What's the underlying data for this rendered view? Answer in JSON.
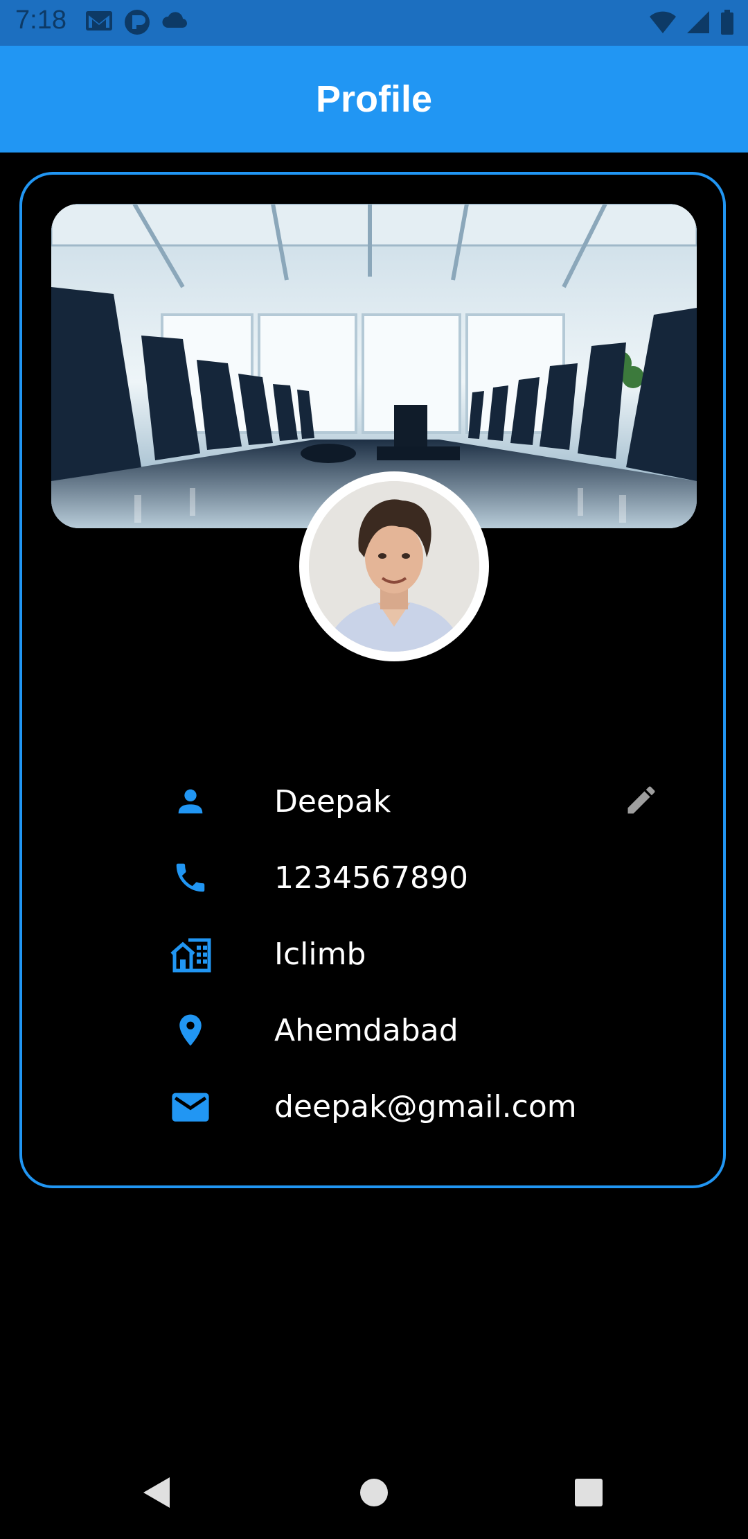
{
  "status_bar": {
    "time": "7:18",
    "left_icons": [
      "gmail-icon",
      "app-icon",
      "cloud-icon"
    ],
    "right_icons": [
      "wifi-icon",
      "signal-icon",
      "battery-icon"
    ]
  },
  "app_bar": {
    "title": "Profile"
  },
  "profile": {
    "cover_image": "conference-room-photo",
    "avatar": "profile-photo",
    "fields": [
      {
        "icon": "person-icon",
        "value": "Deepak"
      },
      {
        "icon": "phone-icon",
        "value": "1234567890"
      },
      {
        "icon": "company-icon",
        "value": "Iclimb"
      },
      {
        "icon": "location-pin-icon",
        "value": "Ahemdabad"
      },
      {
        "icon": "email-icon",
        "value": "deepak@gmail.com"
      }
    ],
    "edit_icon": "pencil-icon"
  },
  "nav_bar": {
    "buttons": [
      "back-icon",
      "home-icon",
      "recents-icon"
    ]
  },
  "colors": {
    "accent": "#2196f3",
    "status_bar": "#1c6fc0",
    "background": "#000000",
    "text": "#ffffff",
    "edit_icon": "#9e9e9e"
  }
}
